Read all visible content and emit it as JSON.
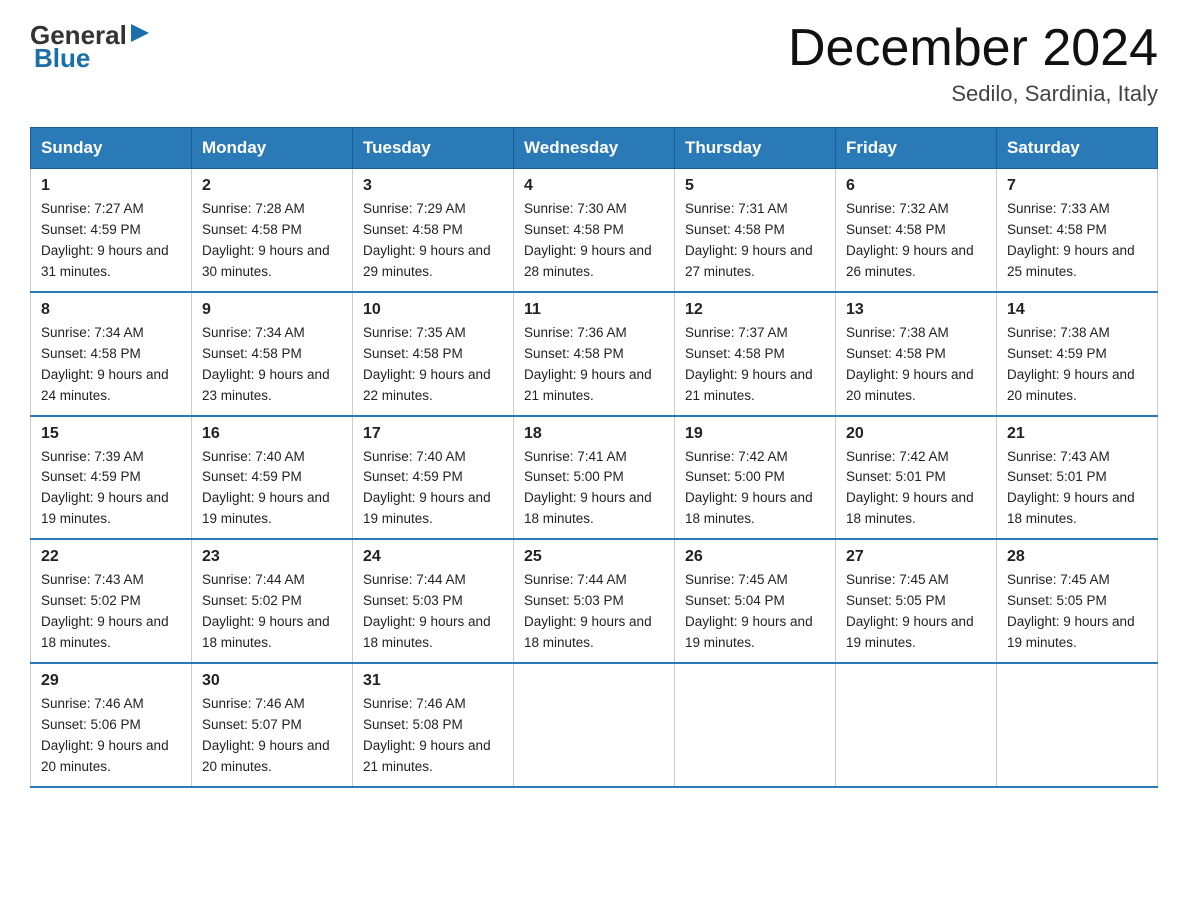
{
  "header": {
    "logo_line1": "General",
    "logo_line2": "Blue",
    "title": "December 2024",
    "subtitle": "Sedilo, Sardinia, Italy"
  },
  "days_of_week": [
    "Sunday",
    "Monday",
    "Tuesday",
    "Wednesday",
    "Thursday",
    "Friday",
    "Saturday"
  ],
  "weeks": [
    [
      {
        "num": "1",
        "sunrise": "7:27 AM",
        "sunset": "4:59 PM",
        "daylight": "9 hours and 31 minutes."
      },
      {
        "num": "2",
        "sunrise": "7:28 AM",
        "sunset": "4:58 PM",
        "daylight": "9 hours and 30 minutes."
      },
      {
        "num": "3",
        "sunrise": "7:29 AM",
        "sunset": "4:58 PM",
        "daylight": "9 hours and 29 minutes."
      },
      {
        "num": "4",
        "sunrise": "7:30 AM",
        "sunset": "4:58 PM",
        "daylight": "9 hours and 28 minutes."
      },
      {
        "num": "5",
        "sunrise": "7:31 AM",
        "sunset": "4:58 PM",
        "daylight": "9 hours and 27 minutes."
      },
      {
        "num": "6",
        "sunrise": "7:32 AM",
        "sunset": "4:58 PM",
        "daylight": "9 hours and 26 minutes."
      },
      {
        "num": "7",
        "sunrise": "7:33 AM",
        "sunset": "4:58 PM",
        "daylight": "9 hours and 25 minutes."
      }
    ],
    [
      {
        "num": "8",
        "sunrise": "7:34 AM",
        "sunset": "4:58 PM",
        "daylight": "9 hours and 24 minutes."
      },
      {
        "num": "9",
        "sunrise": "7:34 AM",
        "sunset": "4:58 PM",
        "daylight": "9 hours and 23 minutes."
      },
      {
        "num": "10",
        "sunrise": "7:35 AM",
        "sunset": "4:58 PM",
        "daylight": "9 hours and 22 minutes."
      },
      {
        "num": "11",
        "sunrise": "7:36 AM",
        "sunset": "4:58 PM",
        "daylight": "9 hours and 21 minutes."
      },
      {
        "num": "12",
        "sunrise": "7:37 AM",
        "sunset": "4:58 PM",
        "daylight": "9 hours and 21 minutes."
      },
      {
        "num": "13",
        "sunrise": "7:38 AM",
        "sunset": "4:58 PM",
        "daylight": "9 hours and 20 minutes."
      },
      {
        "num": "14",
        "sunrise": "7:38 AM",
        "sunset": "4:59 PM",
        "daylight": "9 hours and 20 minutes."
      }
    ],
    [
      {
        "num": "15",
        "sunrise": "7:39 AM",
        "sunset": "4:59 PM",
        "daylight": "9 hours and 19 minutes."
      },
      {
        "num": "16",
        "sunrise": "7:40 AM",
        "sunset": "4:59 PM",
        "daylight": "9 hours and 19 minutes."
      },
      {
        "num": "17",
        "sunrise": "7:40 AM",
        "sunset": "4:59 PM",
        "daylight": "9 hours and 19 minutes."
      },
      {
        "num": "18",
        "sunrise": "7:41 AM",
        "sunset": "5:00 PM",
        "daylight": "9 hours and 18 minutes."
      },
      {
        "num": "19",
        "sunrise": "7:42 AM",
        "sunset": "5:00 PM",
        "daylight": "9 hours and 18 minutes."
      },
      {
        "num": "20",
        "sunrise": "7:42 AM",
        "sunset": "5:01 PM",
        "daylight": "9 hours and 18 minutes."
      },
      {
        "num": "21",
        "sunrise": "7:43 AM",
        "sunset": "5:01 PM",
        "daylight": "9 hours and 18 minutes."
      }
    ],
    [
      {
        "num": "22",
        "sunrise": "7:43 AM",
        "sunset": "5:02 PM",
        "daylight": "9 hours and 18 minutes."
      },
      {
        "num": "23",
        "sunrise": "7:44 AM",
        "sunset": "5:02 PM",
        "daylight": "9 hours and 18 minutes."
      },
      {
        "num": "24",
        "sunrise": "7:44 AM",
        "sunset": "5:03 PM",
        "daylight": "9 hours and 18 minutes."
      },
      {
        "num": "25",
        "sunrise": "7:44 AM",
        "sunset": "5:03 PM",
        "daylight": "9 hours and 18 minutes."
      },
      {
        "num": "26",
        "sunrise": "7:45 AM",
        "sunset": "5:04 PM",
        "daylight": "9 hours and 19 minutes."
      },
      {
        "num": "27",
        "sunrise": "7:45 AM",
        "sunset": "5:05 PM",
        "daylight": "9 hours and 19 minutes."
      },
      {
        "num": "28",
        "sunrise": "7:45 AM",
        "sunset": "5:05 PM",
        "daylight": "9 hours and 19 minutes."
      }
    ],
    [
      {
        "num": "29",
        "sunrise": "7:46 AM",
        "sunset": "5:06 PM",
        "daylight": "9 hours and 20 minutes."
      },
      {
        "num": "30",
        "sunrise": "7:46 AM",
        "sunset": "5:07 PM",
        "daylight": "9 hours and 20 minutes."
      },
      {
        "num": "31",
        "sunrise": "7:46 AM",
        "sunset": "5:08 PM",
        "daylight": "9 hours and 21 minutes."
      },
      null,
      null,
      null,
      null
    ]
  ],
  "colors": {
    "header_bg": "#2a7ab8",
    "header_text": "#ffffff",
    "border": "#999",
    "row_border": "#2a7ab8"
  }
}
